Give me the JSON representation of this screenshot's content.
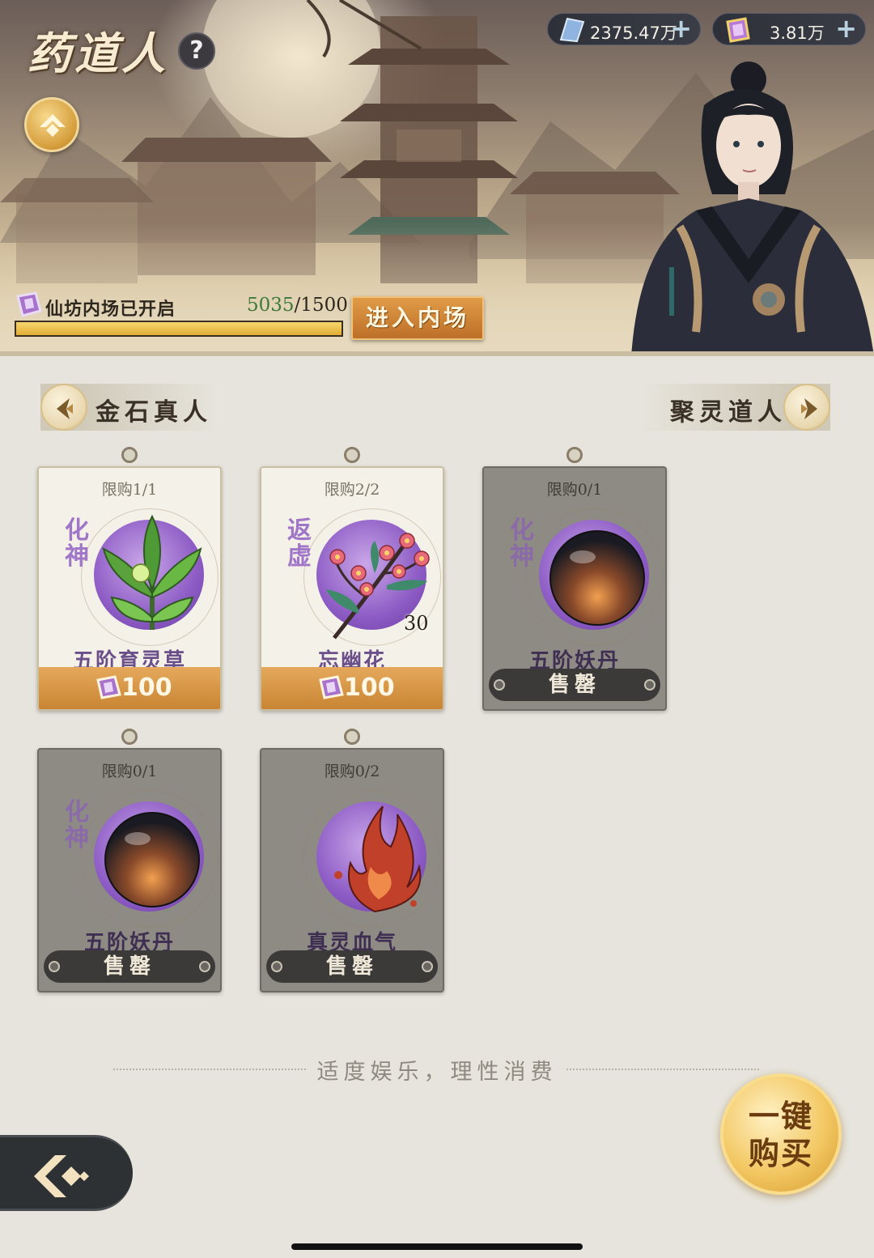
{
  "header": {
    "title": "药道人",
    "help_label": "?",
    "currencies": [
      {
        "name": "spirit-stone",
        "value": "2375.47万",
        "icon": "crystal-icon",
        "plus": "+"
      },
      {
        "name": "jade",
        "value": "3.81万",
        "icon": "jade-token-icon",
        "plus": "+"
      }
    ],
    "market": {
      "label": "仙坊内场已开启",
      "current": "5035",
      "sep_total": "/1500",
      "progress": 1.0,
      "enter_label": "进入内场"
    }
  },
  "nav": {
    "prev_label": "金石真人",
    "next_label": "聚灵道人"
  },
  "items": [
    {
      "limit": "限购1/1",
      "tier": "化神",
      "name": "五阶育灵草",
      "price": "100",
      "sold_out": false,
      "qty": "",
      "art": "herb-icon"
    },
    {
      "limit": "限购2/2",
      "tier": "返虚",
      "name": "忘幽花",
      "price": "100",
      "sold_out": false,
      "qty": "30",
      "art": "flower-icon"
    },
    {
      "limit": "限购0/1",
      "tier": "化神",
      "name": "五阶妖丹",
      "price": "",
      "sold_out": true,
      "sold_label": "售罄",
      "qty": "",
      "art": "demon-core-icon"
    },
    {
      "limit": "限购0/1",
      "tier": "化神",
      "name": "五阶妖丹",
      "price": "",
      "sold_out": true,
      "sold_label": "售罄",
      "qty": "",
      "art": "demon-core-icon"
    },
    {
      "limit": "限购0/2",
      "tier": "",
      "name": "真灵血气",
      "price": "",
      "sold_out": true,
      "sold_label": "售罄",
      "qty": "",
      "art": "blood-flame-icon"
    }
  ],
  "footer": {
    "notice": "适度娱乐，理性消费",
    "buy_all_line1": "一键",
    "buy_all_line2": "购买"
  },
  "colors": {
    "accent_gold": "#e2ad35",
    "tier_purple": "#9f76c8",
    "price_orange": "#c98533",
    "sold_gray": "#8e8b84"
  }
}
